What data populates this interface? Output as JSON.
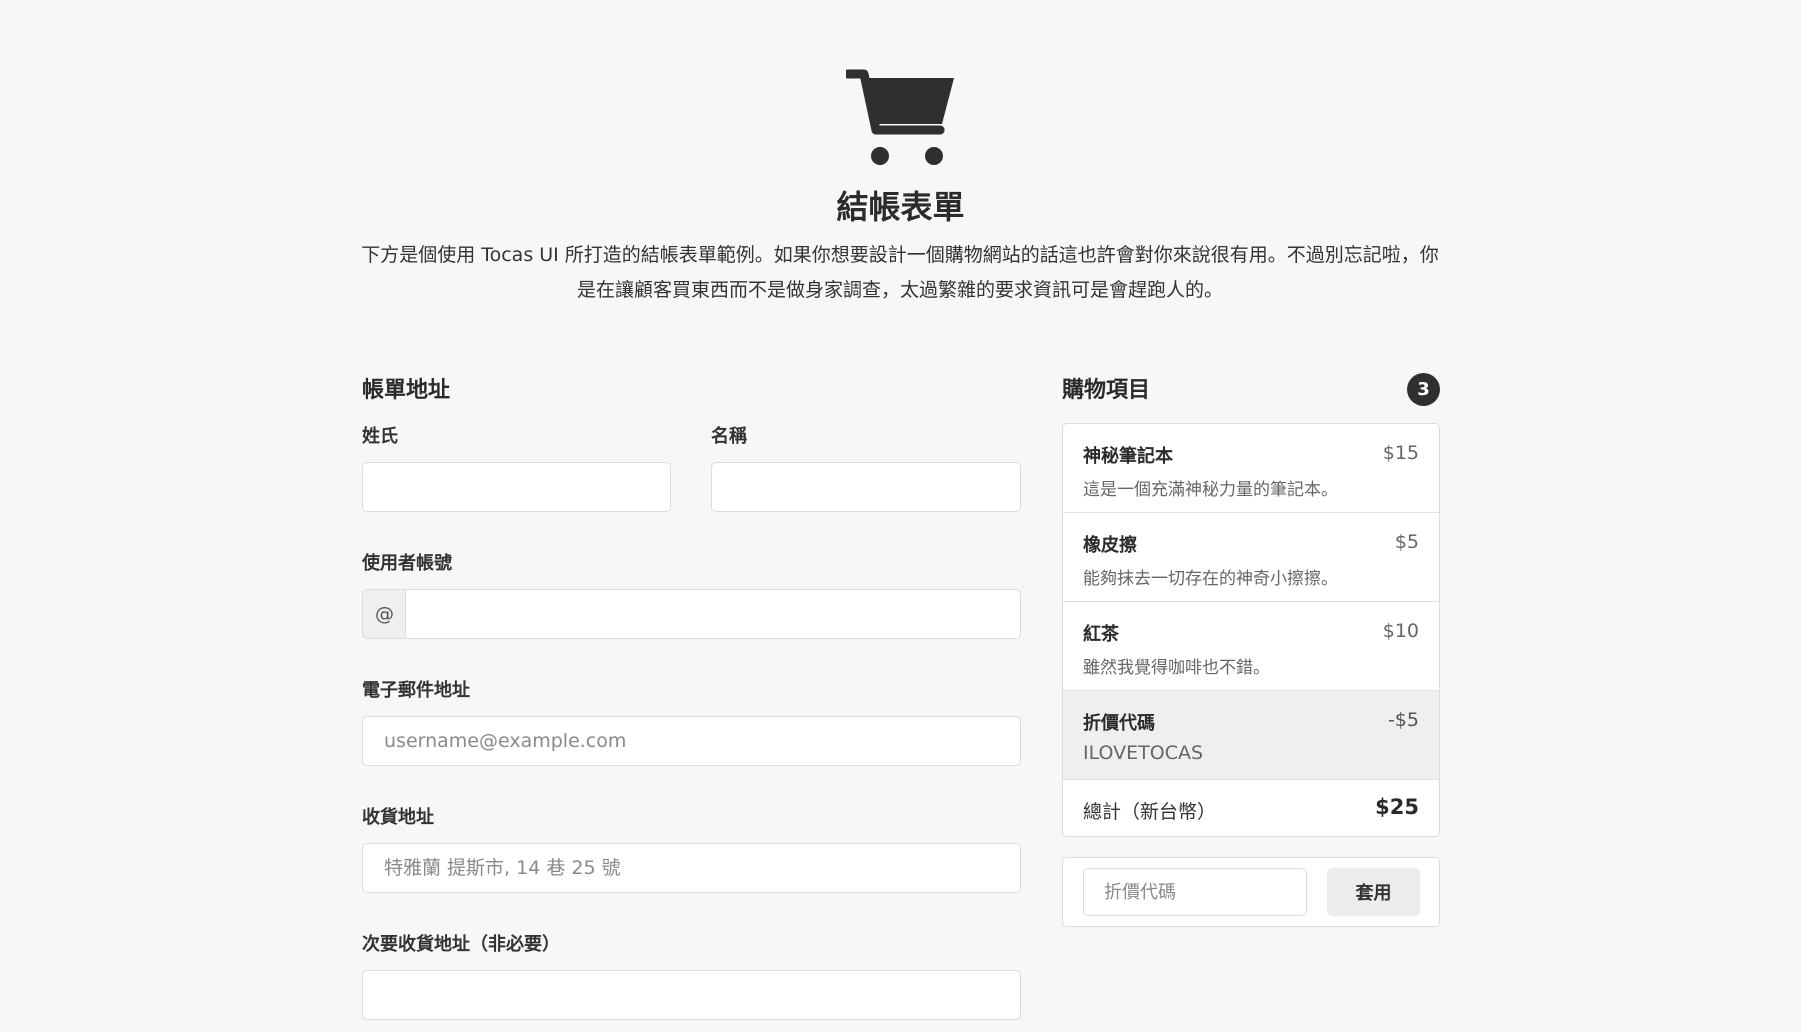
{
  "header": {
    "icon": "shopping-cart-icon",
    "title": "結帳表單",
    "description": "下方是個使用 Tocas UI 所打造的結帳表單範例。如果你想要設計一個購物網站的話這也許會對你來說很有用。不過別忘記啦，你是在讓顧客買東西而不是做身家調查，太過繁雜的要求資訊可是會趕跑人的。"
  },
  "billing": {
    "title": "帳單地址",
    "last_name_label": "姓氏",
    "first_name_label": "名稱",
    "username_label": "使用者帳號",
    "username_addon": "@",
    "email_label": "電子郵件地址",
    "email_placeholder": "username@example.com",
    "address_label": "收貨地址",
    "address_placeholder": "特雅蘭 提斯市, 14 巷 25 號",
    "address2_label": "次要收貨地址（非必要）"
  },
  "cart": {
    "title": "購物項目",
    "count": "3",
    "items": [
      {
        "name": "神秘筆記本",
        "price": "$15",
        "description": "這是一個充滿神秘力量的筆記本。"
      },
      {
        "name": "橡皮擦",
        "price": "$5",
        "description": "能夠抹去一切存在的神奇小擦擦。"
      },
      {
        "name": "紅茶",
        "price": "$10",
        "description": "雖然我覺得咖啡也不錯。"
      }
    ],
    "discount": {
      "name": "折價代碼",
      "price": "-$5",
      "code": "ILOVETOCAS"
    },
    "total": {
      "label": "總計（新台幣）",
      "value": "$25"
    }
  },
  "promo": {
    "placeholder": "折價代碼",
    "apply_label": "套用"
  }
}
